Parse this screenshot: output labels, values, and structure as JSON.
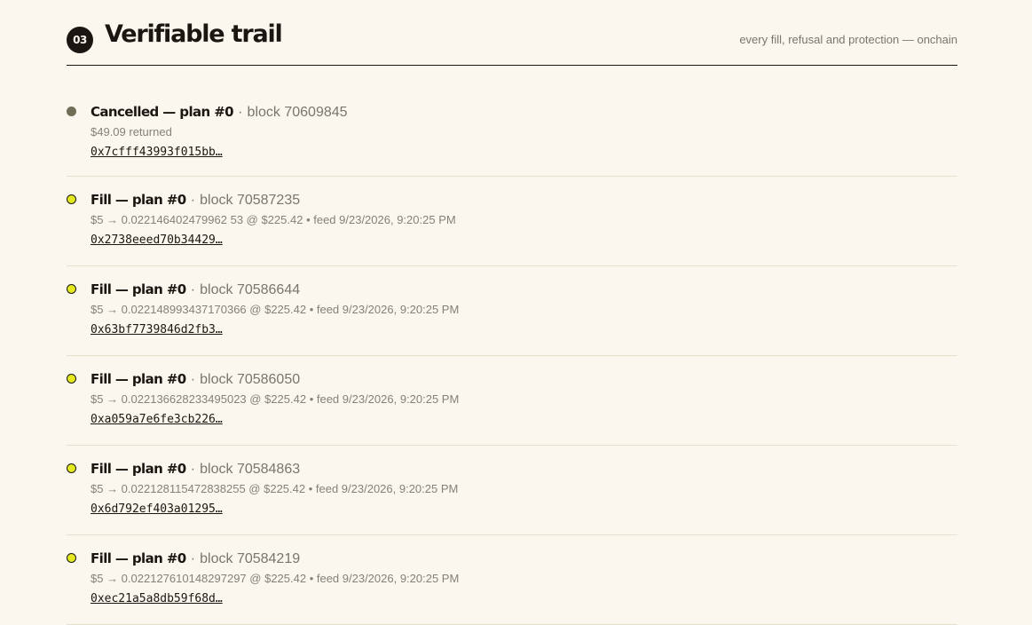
{
  "section": {
    "number": "03",
    "title": "Verifiable trail",
    "tagline": "every fill, refusal and protection — onchain"
  },
  "separator": "·",
  "events": [
    {
      "kind": "cancel",
      "title": "Cancelled — plan #0",
      "block": "block 70609845",
      "detail": "$49.09 returned",
      "tx": "0x7cfff43993f015bb…"
    },
    {
      "kind": "fill",
      "title": "Fill — plan #0",
      "block": "block 70587235",
      "detail": "$5 → 0.022146402479962 53 @ $225.42 • feed 9/23/2026, 9:20:25 PM",
      "tx": "0x2738eeed70b34429…"
    },
    {
      "kind": "fill",
      "title": "Fill — plan #0",
      "block": "block 70586644",
      "detail": "$5 → 0.022148993437170366 @ $225.42 • feed 9/23/2026, 9:20:25 PM",
      "tx": "0x63bf7739846d2fb3…"
    },
    {
      "kind": "fill",
      "title": "Fill — plan #0",
      "block": "block 70586050",
      "detail": "$5 → 0.022136628233495023 @ $225.42 • feed 9/23/2026, 9:20:25 PM",
      "tx": "0xa059a7e6fe3cb226…"
    },
    {
      "kind": "fill",
      "title": "Fill — plan #0",
      "block": "block 70584863",
      "detail": "$5 → 0.022128115472838255 @ $225.42 • feed 9/23/2026, 9:20:25 PM",
      "tx": "0x6d792ef403a01295…"
    },
    {
      "kind": "fill",
      "title": "Fill — plan #0",
      "block": "block 70584219",
      "detail": "$5 → 0.022127610148297297 @ $225.42 • feed 9/23/2026, 9:20:25 PM",
      "tx": "0xec21a5a8db59f68d…"
    }
  ],
  "colors": {
    "background": "#faf7ee",
    "ink": "#1a1712",
    "muted": "#7a766c",
    "fill_dot": "#e4e81e",
    "cancel_dot": "#6f6e57",
    "divider": "#e6e1cf"
  }
}
